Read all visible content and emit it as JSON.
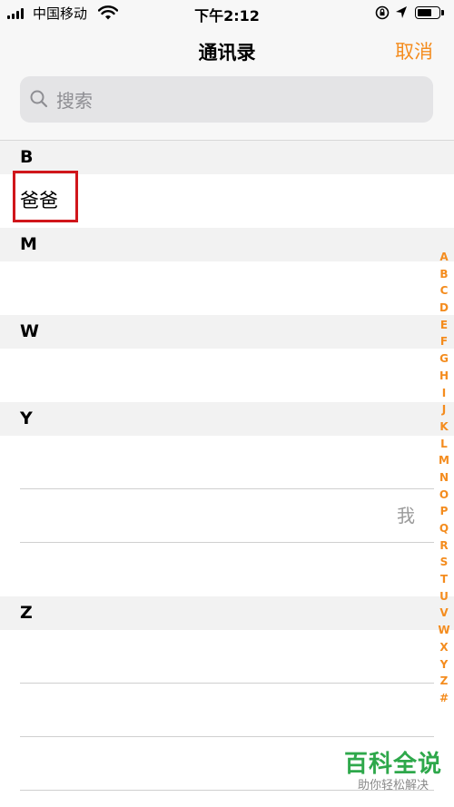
{
  "status_bar": {
    "carrier": "中国移动",
    "time": "下午2:12",
    "battery_level": 0.7
  },
  "nav": {
    "title": "通讯录",
    "cancel_label": "取消"
  },
  "search": {
    "placeholder": "搜索"
  },
  "sections": [
    {
      "letter": "B",
      "rows": [
        {
          "name": "爸爸"
        }
      ]
    },
    {
      "letter": "M",
      "rows": [
        {
          "name": ""
        }
      ]
    },
    {
      "letter": "W",
      "rows": [
        {
          "name": ""
        }
      ]
    },
    {
      "letter": "Y",
      "rows": [
        {
          "name": ""
        },
        {
          "name": "",
          "me_label": "我"
        },
        {
          "name": ""
        }
      ]
    },
    {
      "letter": "Z",
      "rows": [
        {
          "name": ""
        },
        {
          "name": ""
        },
        {
          "name": ""
        }
      ]
    }
  ],
  "index_letters": [
    "A",
    "B",
    "C",
    "D",
    "E",
    "F",
    "G",
    "H",
    "I",
    "J",
    "K",
    "L",
    "M",
    "N",
    "O",
    "P",
    "Q",
    "R",
    "S",
    "T",
    "U",
    "V",
    "W",
    "X",
    "Y",
    "Z",
    "#"
  ],
  "watermark": {
    "title": "百科全说",
    "subtitle": "助你轻松解决"
  },
  "colors": {
    "accent": "#f48c1e",
    "highlight": "#d0161b",
    "watermark": "#2ea84b"
  }
}
